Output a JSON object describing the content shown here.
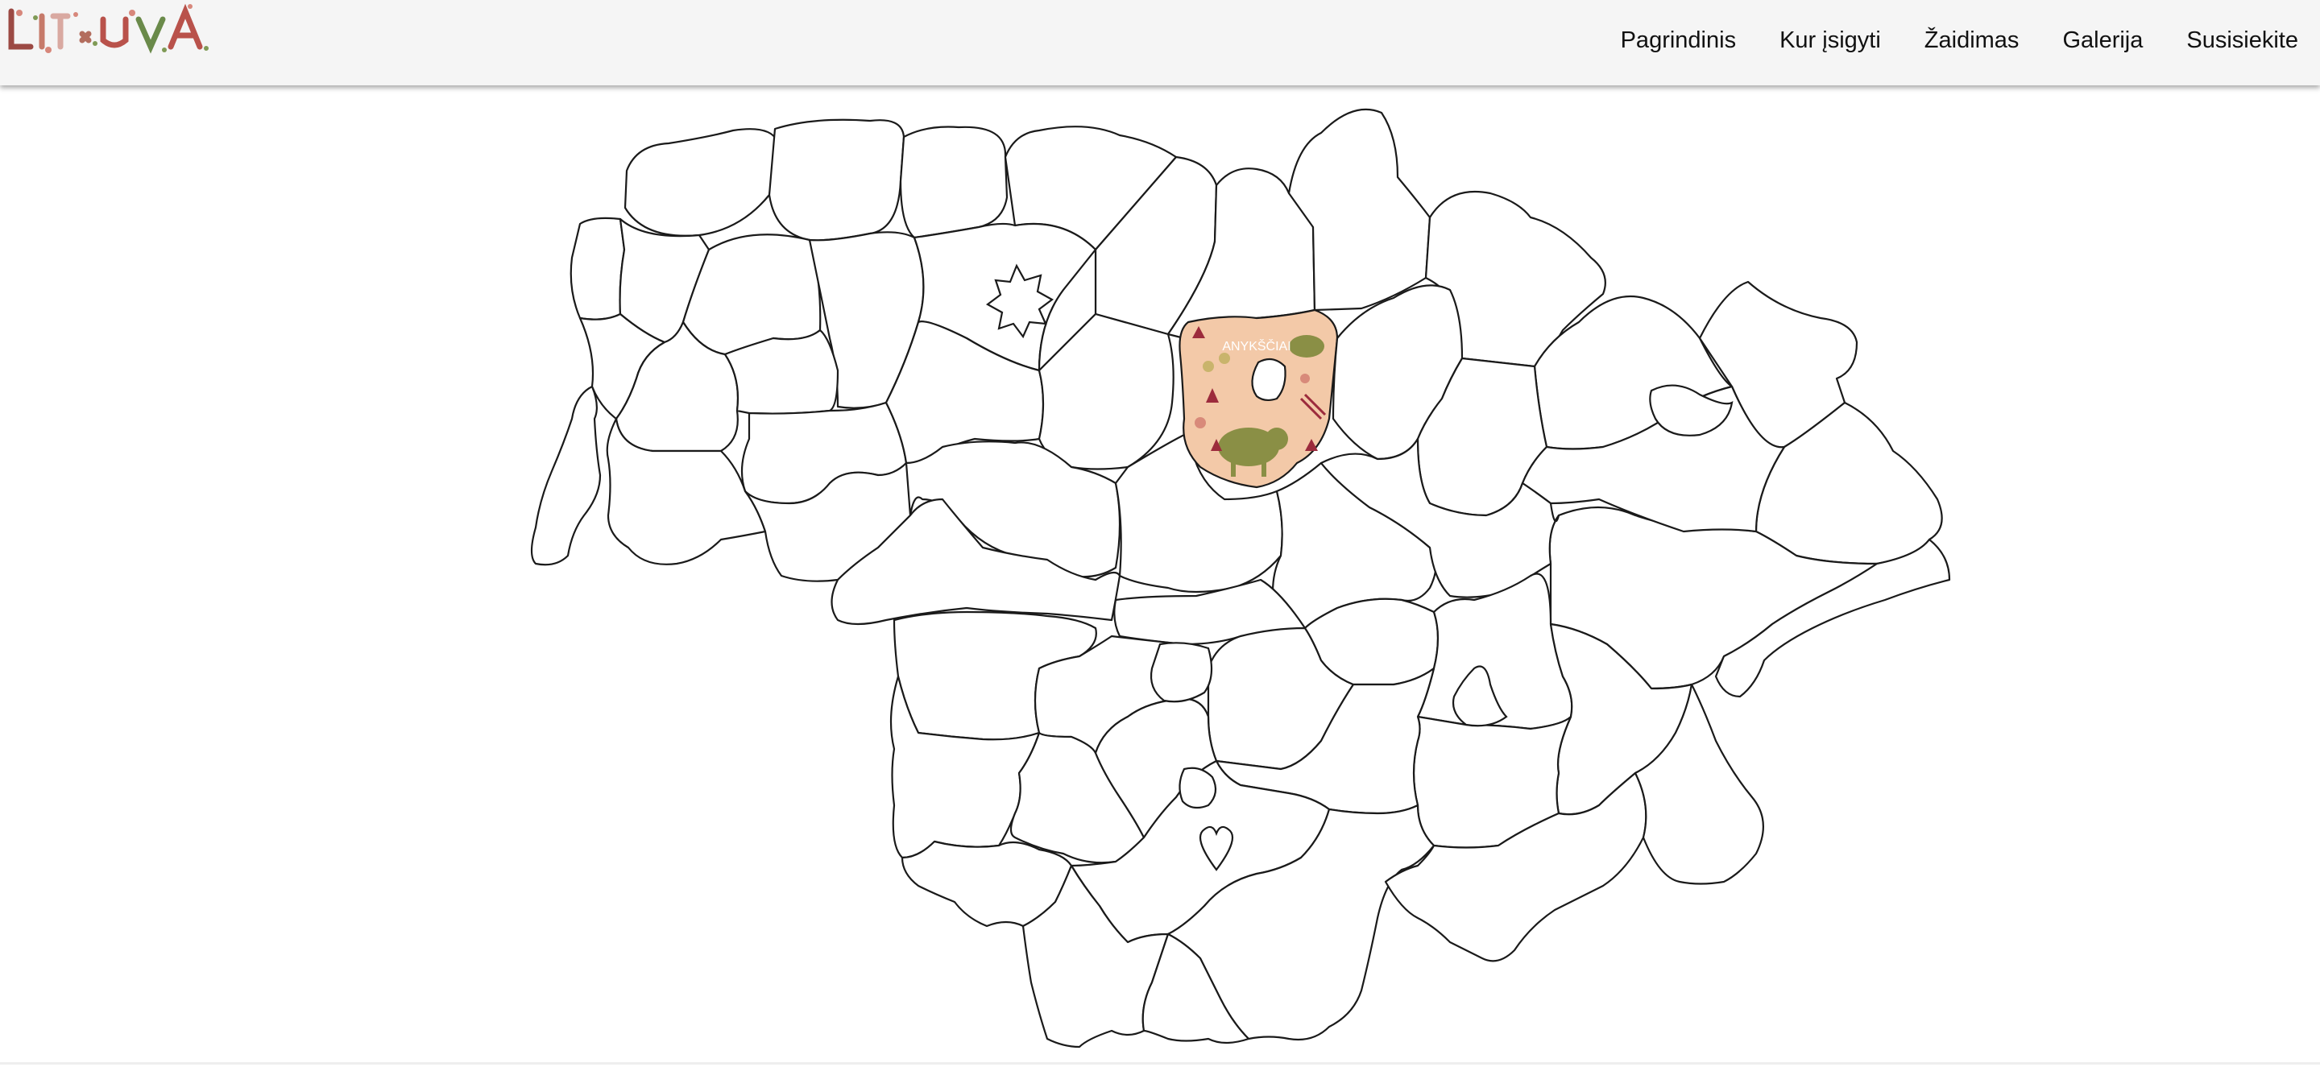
{
  "header": {
    "logo_text": "LIETUVA",
    "logo_icon": "lietuva-floral-logo"
  },
  "nav": {
    "items": [
      {
        "label": "Pagrindinis"
      },
      {
        "label": "Kur įsigyti"
      },
      {
        "label": "Žaidimas"
      },
      {
        "label": "Galerija"
      },
      {
        "label": "Susisiekite"
      }
    ]
  },
  "map": {
    "name": "Lithuania puzzle map",
    "highlight_fill": "#f3c9a8",
    "highlight_illustration": "bison-and-forest-illustration",
    "highlight_caption": "ANYKŠČIAI"
  },
  "colors": {
    "header_bg": "#f5f5f5",
    "outline": "#1a1a1a",
    "highlight": "#f3c9a8",
    "bison": "#8a8f45",
    "trees": "#9c2b3c"
  }
}
